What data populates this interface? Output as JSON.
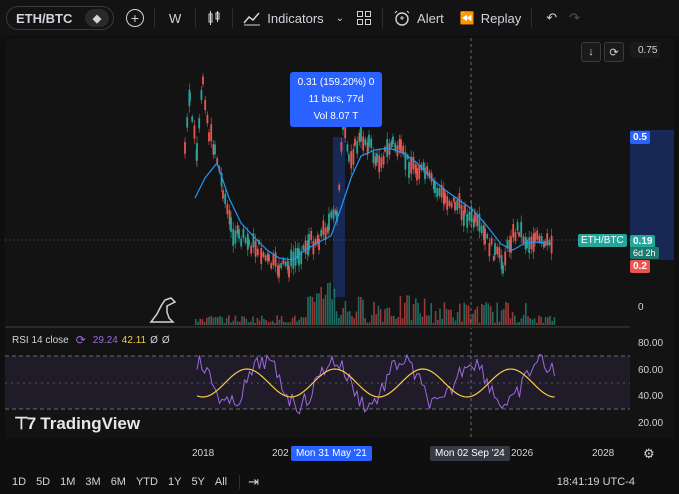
{
  "toolbar": {
    "symbol": "ETH/BTC",
    "interval": "W",
    "indicators_label": "Indicators",
    "alert_label": "Alert",
    "replay_label": "Replay"
  },
  "price_scale": {
    "labels": [
      "0.75",
      "0.5",
      "0.2",
      "0"
    ],
    "current_symbol": "ETH/BTC",
    "current_price": "0.19",
    "countdown": "6d 2h",
    "range_low": "0.2",
    "range_high": "0.5"
  },
  "measure_tooltip": {
    "line1": "0.31 (159.20%) 0",
    "line2": "11 bars, 77d",
    "line3": "Vol 8.07 T"
  },
  "rsi": {
    "title": "RSI 14 close",
    "value_rsi": "29.24",
    "value_ma": "42.11",
    "extra1": "Ø",
    "extra2": "Ø",
    "labels": [
      "80.00",
      "60.00",
      "40.00",
      "20.00"
    ]
  },
  "brand": {
    "name": "TradingView"
  },
  "time_axis": {
    "labels": [
      "2018",
      "202",
      "2026",
      "2028"
    ],
    "highlight_left": "Mon 31 May '21",
    "highlight_right": "Mon 02 Sep '24"
  },
  "bottom": {
    "ranges": [
      "1D",
      "5D",
      "1M",
      "3M",
      "6M",
      "YTD",
      "1Y",
      "5Y",
      "All"
    ],
    "clock": "18:41:19 UTC-4"
  },
  "colors": {
    "up": "#26a69a",
    "down": "#ef5350",
    "accent": "#2962ff",
    "ma": "#2196f3",
    "rsi": "#9c6ade",
    "rsi_ma": "#f7c948"
  }
}
